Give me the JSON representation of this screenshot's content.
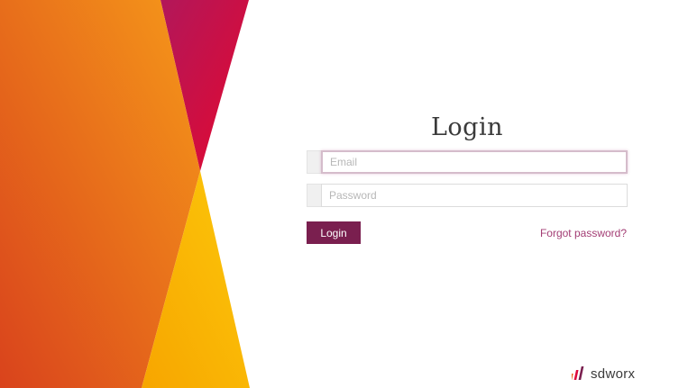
{
  "page": {
    "title": "Login"
  },
  "form": {
    "email": {
      "placeholder": "Email",
      "value": ""
    },
    "password": {
      "placeholder": "Password",
      "value": ""
    },
    "login_label": "Login",
    "forgot_label": "Forgot password?"
  },
  "brand": {
    "logo_text": "sdworx",
    "colors": {
      "primary": "#7a1f4f",
      "link": "#a33d74",
      "orange": "#e8661a",
      "yellow": "#f8bb00",
      "crimson": "#dd0a3c"
    }
  }
}
